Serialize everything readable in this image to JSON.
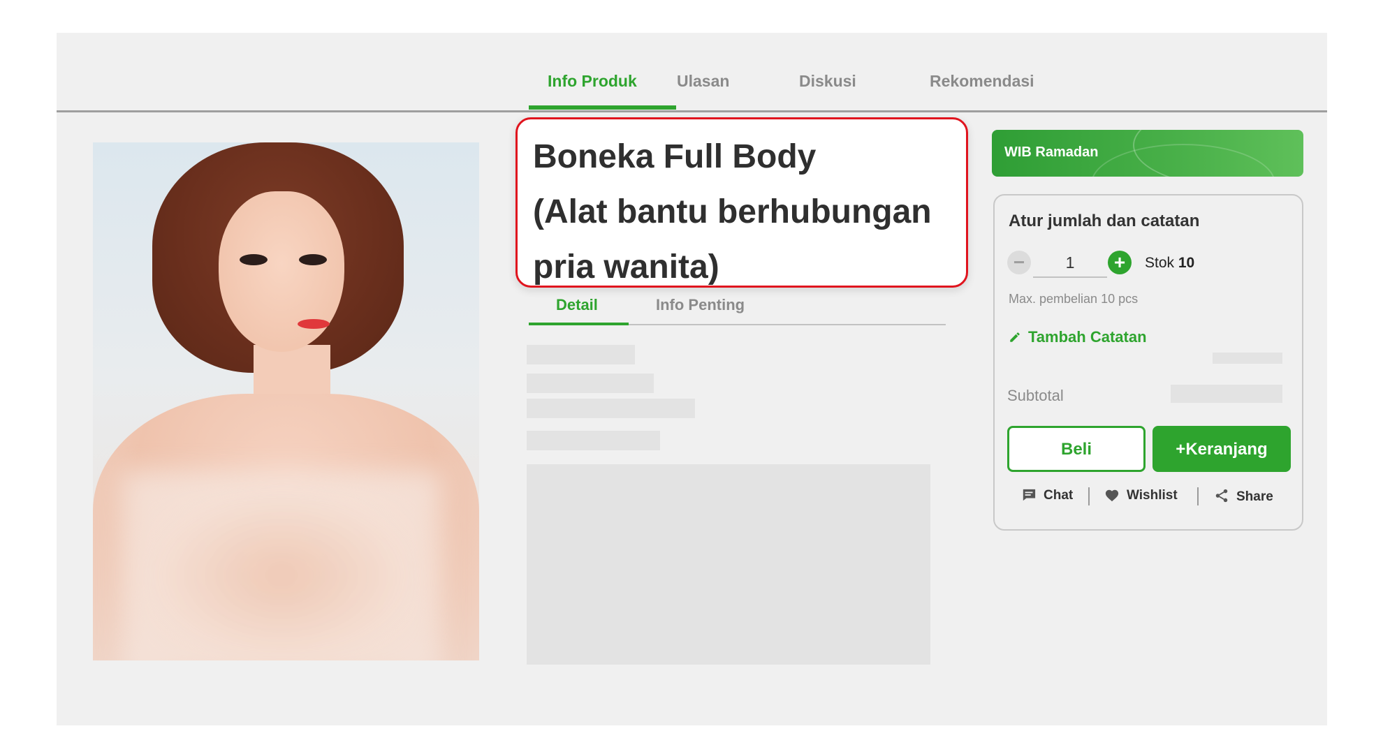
{
  "tabs": [
    {
      "label": "Info Produk",
      "active": true
    },
    {
      "label": "Ulasan",
      "active": false
    },
    {
      "label": "Diskusi",
      "active": false
    },
    {
      "label": "Rekomendasi",
      "active": false
    }
  ],
  "product": {
    "title_lines": [
      "Boneka Full Body",
      "(Alat bantu berhubungan",
      "pria wanita)"
    ]
  },
  "detail_tabs": [
    {
      "label": "Detail",
      "active": true
    },
    {
      "label": "Info Penting",
      "active": false
    }
  ],
  "promo": {
    "label": "WIB Ramadan"
  },
  "purchase": {
    "title": "Atur jumlah dan catatan",
    "quantity": "1",
    "stock_label": "Stok",
    "stock_value": "10",
    "max_note": "Max. pembelian 10 pcs",
    "add_note": "Tambah Catatan",
    "subtotal_label": "Subtotal",
    "buy_label": "Beli",
    "cart_label": "+Keranjang"
  },
  "actions": [
    {
      "label": "Chat",
      "icon": "chat-icon"
    },
    {
      "label": "Wishlist",
      "icon": "heart-icon"
    },
    {
      "label": "Share",
      "icon": "share-icon"
    }
  ],
  "colors": {
    "accent": "#2ea42e",
    "highlight_border": "#e0141e",
    "muted_text": "#8a8a8a",
    "background": "#f0f0f0"
  }
}
